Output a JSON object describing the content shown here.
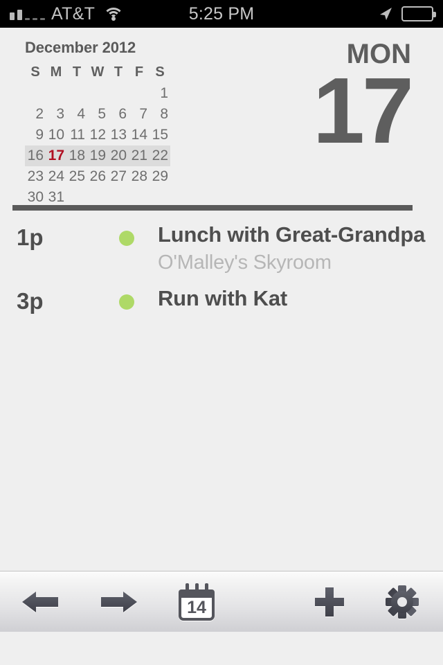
{
  "statusbar": {
    "carrier": "AT&T",
    "time": "5:25 PM",
    "signal_icon": "signal-bars-icon",
    "wifi_icon": "wifi-icon",
    "location_icon": "location-arrow-icon",
    "battery_icon": "battery-icon"
  },
  "calendar": {
    "month_title": "December 2012",
    "weekday_headers": [
      "S",
      "M",
      "T",
      "W",
      "T",
      "F",
      "S"
    ],
    "weeks": [
      [
        "",
        "",
        "",
        "",
        "",
        "",
        "1"
      ],
      [
        "2",
        "3",
        "4",
        "5",
        "6",
        "7",
        "8"
      ],
      [
        "9",
        "10",
        "11",
        "12",
        "13",
        "14",
        "15"
      ],
      [
        "16",
        "17",
        "18",
        "19",
        "20",
        "21",
        "22"
      ],
      [
        "23",
        "24",
        "25",
        "26",
        "27",
        "28",
        "29"
      ],
      [
        "30",
        "31",
        "",
        "",
        "",
        "",
        ""
      ]
    ],
    "highlighted_week_index": 3,
    "today": "17",
    "today_color": "#b00f22",
    "highlight_color": "#dcdcdc"
  },
  "selected_day": {
    "weekday": "MON",
    "day_number": "17"
  },
  "events": [
    {
      "time": "1p",
      "title": "Lunch with Great-Grandpa",
      "location": "O'Malley's Skyroom",
      "dot_color": "#aed967"
    },
    {
      "time": "3p",
      "title": "Run with Kat",
      "location": "",
      "dot_color": "#aed967"
    }
  ],
  "toolbar": {
    "back_icon": "arrow-left-icon",
    "forward_icon": "arrow-right-icon",
    "today_icon": "calendar-icon",
    "today_icon_day": "14",
    "add_icon": "plus-icon",
    "settings_icon": "gear-icon"
  },
  "theme": {
    "background": "#efefef",
    "text_dark": "#4e4e4e",
    "text_muted": "#b6b6b6",
    "accent_green": "#aed967",
    "accent_red": "#b00f22"
  }
}
